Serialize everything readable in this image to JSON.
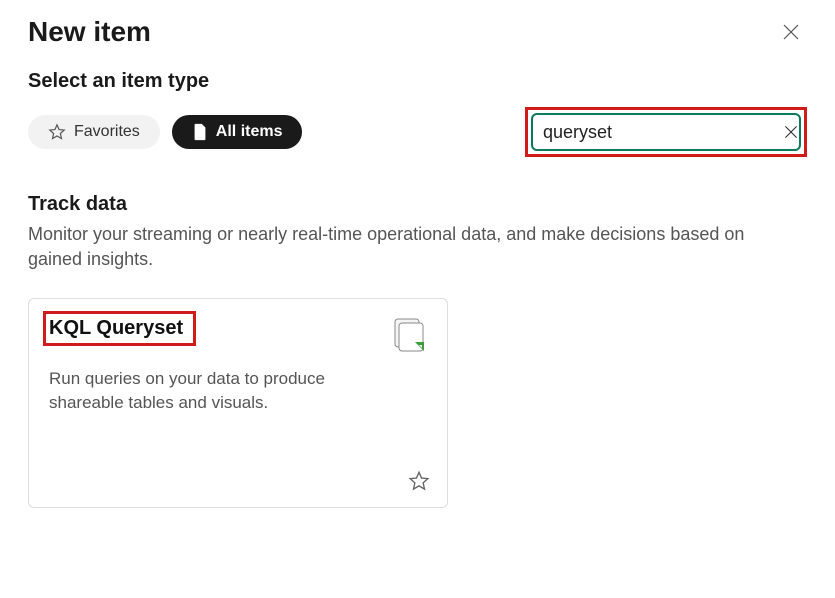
{
  "dialog": {
    "title": "New item"
  },
  "subtitle": "Select an item type",
  "pills": {
    "favorites_label": "Favorites",
    "allitems_label": "All items"
  },
  "search": {
    "value": "queryset",
    "placeholder": ""
  },
  "section": {
    "title": "Track data",
    "description": "Monitor your streaming or nearly real-time operational data, and make decisions based on gained insights."
  },
  "card": {
    "title": "KQL Queryset",
    "description": "Run queries on your data to produce shareable tables and visuals."
  }
}
